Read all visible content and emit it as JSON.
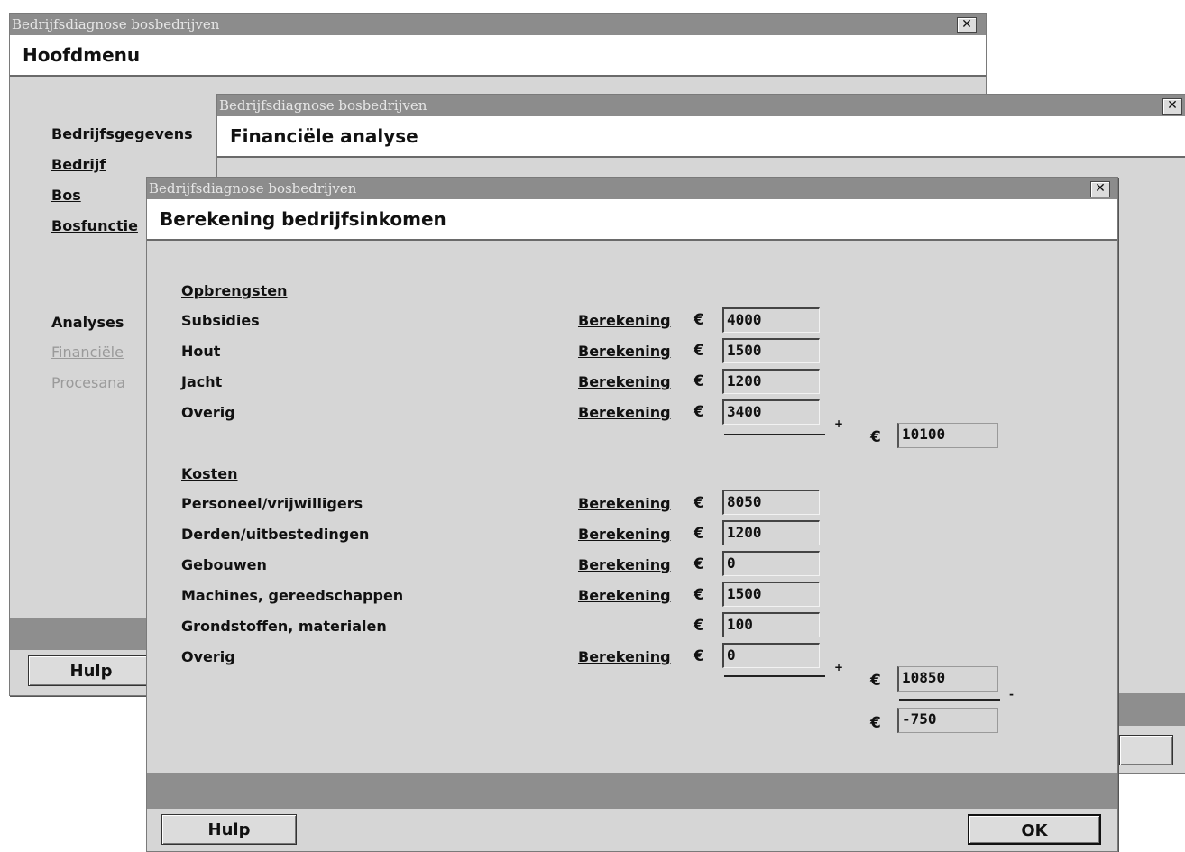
{
  "window_main": {
    "title": "Bedrijfsdiagnose bosbedrijven",
    "header": "Hoofdmenu",
    "section_bedrijfsgegevens": "Bedrijfsgegevens",
    "links": [
      "Bedrijf",
      "Bos",
      "Bosfunctie"
    ],
    "section_analyses": "Analyses",
    "analyses_links": [
      "Financiële",
      "Procesana"
    ],
    "help_button": "Hulp"
  },
  "window_financial": {
    "title": "Bedrijfsdiagnose bosbedrijven",
    "header": "Financiële analyse"
  },
  "window_income": {
    "title": "Bedrijfsdiagnose bosbedrijven",
    "header": "Berekening bedrijfsinkomen",
    "currency_symbol": "€",
    "calc_link_label": "Berekening",
    "revenue": {
      "heading": "Opbrengsten",
      "rows": [
        {
          "label": "Subsidies",
          "value": "4000"
        },
        {
          "label": "Hout",
          "value": "1500"
        },
        {
          "label": "Jacht",
          "value": "1200"
        },
        {
          "label": "Overig",
          "value": "3400"
        }
      ],
      "plus": "+",
      "total": "10100"
    },
    "costs": {
      "heading": "Kosten",
      "rows": [
        {
          "label": "Personeel/vrijwilligers",
          "value": "8050"
        },
        {
          "label": "Derden/uitbestedingen",
          "value": "1200"
        },
        {
          "label": "Gebouwen",
          "value": "0"
        },
        {
          "label": "Machines, gereedschappen",
          "value": "1500"
        },
        {
          "label": "Grondstoffen, materialen",
          "value": "100"
        },
        {
          "label": "Overig",
          "value": "0"
        }
      ],
      "plus": "+",
      "total": "10850",
      "minus": "-"
    },
    "result": "-750",
    "help_button": "Hulp",
    "ok_button": "OK"
  }
}
